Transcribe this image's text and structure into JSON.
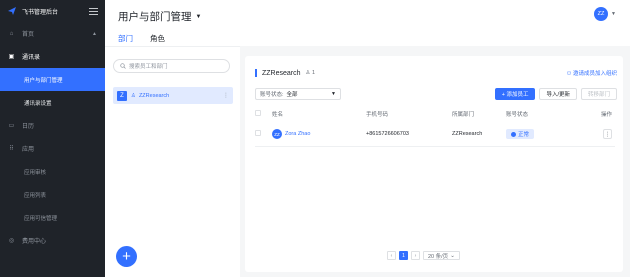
{
  "sidebar": {
    "brand": "飞书管理后台",
    "items": [
      {
        "label": "首页",
        "icon": "home-icon"
      },
      {
        "label": "通讯录",
        "icon": "contacts-icon"
      },
      {
        "label": "日历",
        "icon": "calendar-icon"
      },
      {
        "label": "应用",
        "icon": "apps-icon"
      },
      {
        "label": "费用中心",
        "icon": "billing-icon"
      }
    ],
    "contacts_sub": [
      "用户与部门管理",
      "通讯录设置"
    ],
    "apps_sub": [
      "应用审核",
      "应用列表",
      "应用可信管理"
    ]
  },
  "header": {
    "title": "用户与部门管理",
    "tabs": [
      "部门",
      "角色"
    ],
    "user_initials": "ZZ"
  },
  "dept_panel": {
    "search_placeholder": "搜索员工和部门",
    "root_badge": "Z",
    "root_name": "ZZResearch"
  },
  "members": {
    "title": "ZZResearch",
    "count": "1",
    "invite_label": "邀请成员加入组织",
    "filter_label": "账号状态:",
    "filter_value": "全部",
    "buttons": {
      "add": "+ 添加员工",
      "import": "导入/更新",
      "remove": "转移部门"
    },
    "columns": [
      "姓名",
      "手机号码",
      "所属部门",
      "账号状态",
      "操作"
    ],
    "rows": [
      {
        "initials": "ZZ",
        "name": "Zora Zhao",
        "phone": "+8615726606703",
        "dept": "ZZResearch",
        "status": "正常"
      }
    ],
    "pagination": {
      "current": "1",
      "page_size": "20 条/页"
    }
  },
  "colors": {
    "accent": "#3370ff",
    "sidebar_bg": "#1f2329"
  }
}
